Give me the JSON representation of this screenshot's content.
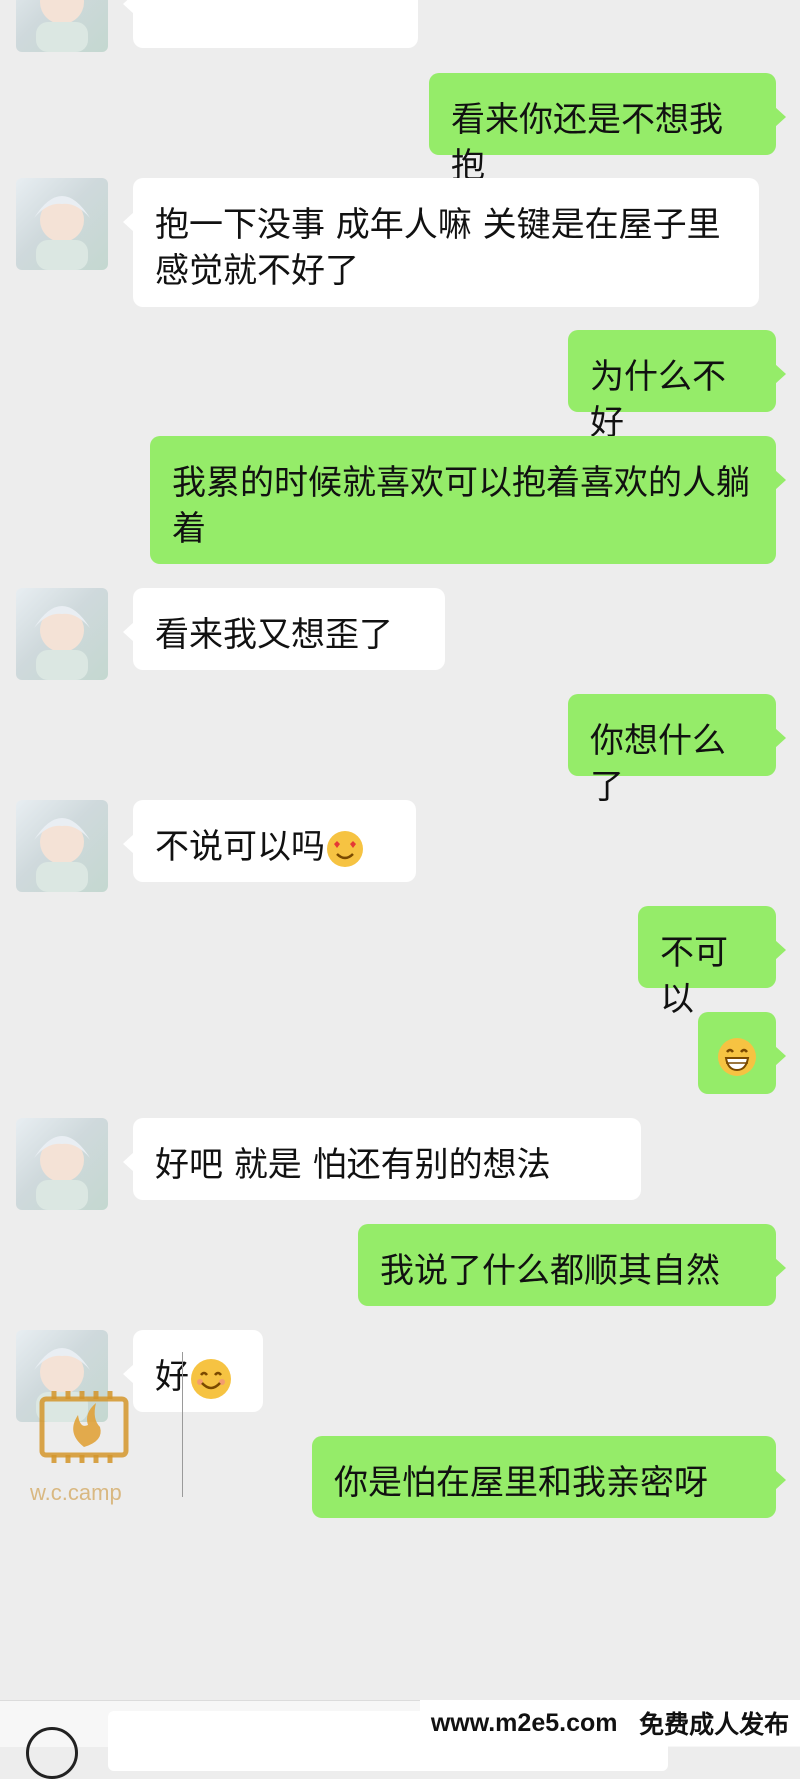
{
  "messages": [
    {
      "side": "in",
      "text": "",
      "emoji": ""
    },
    {
      "side": "out",
      "text": "看来你还是不想我抱",
      "emoji": ""
    },
    {
      "side": "in",
      "text": "抱一下没事  成年人嘛   关键是在屋子里  感觉就不好了",
      "emoji": ""
    },
    {
      "side": "out",
      "text": "为什么不好",
      "emoji": ""
    },
    {
      "side": "out",
      "text": "我累的时候就喜欢可以抱着喜欢的人躺着",
      "emoji": ""
    },
    {
      "side": "in",
      "text": "看来我又想歪了",
      "emoji": ""
    },
    {
      "side": "out",
      "text": "你想什么了",
      "emoji": ""
    },
    {
      "side": "in",
      "text": "不说可以吗",
      "emoji": "heart-eyes-emoji"
    },
    {
      "side": "out",
      "text": "不可以",
      "emoji": ""
    },
    {
      "side": "out",
      "text": "",
      "emoji": "grin-emoji"
    },
    {
      "side": "in",
      "text": "好吧   就是 怕还有别的想法",
      "emoji": ""
    },
    {
      "side": "out",
      "text": "我说了什么都顺其自然",
      "emoji": ""
    },
    {
      "side": "in",
      "text": "好",
      "emoji": "smile-emoji"
    },
    {
      "side": "out",
      "text": "你是怕在屋里和我亲密呀",
      "emoji": ""
    }
  ],
  "watermark": {
    "camp_text": "w.c.camp"
  },
  "footer": {
    "site": "www.m2e5.com",
    "slogan": "免费成人发布"
  },
  "colors": {
    "background": "#ededed",
    "outgoing_bubble": "#95ec69",
    "incoming_bubble": "#ffffff"
  }
}
